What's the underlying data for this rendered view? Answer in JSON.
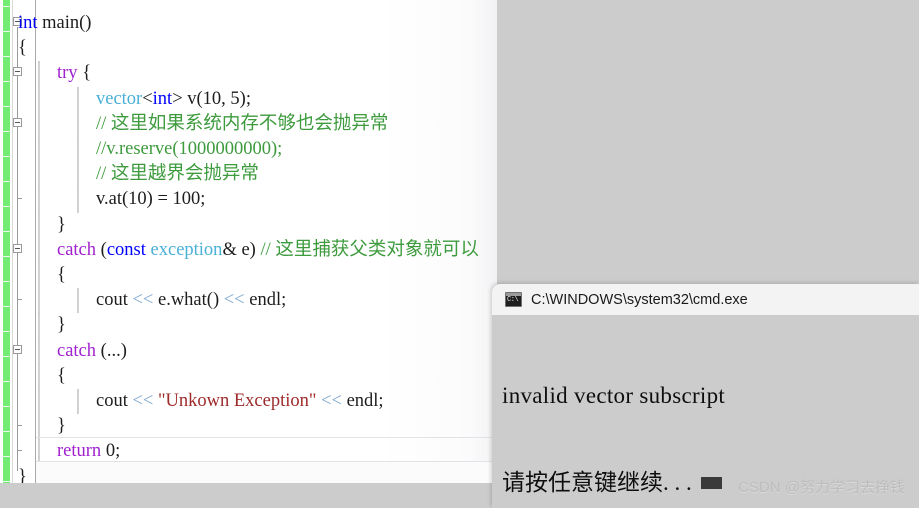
{
  "editor": {
    "name": "code-editor",
    "language": "cpp",
    "change_bar_color": "#72ec72",
    "background": "#ffffff",
    "lines": [
      {
        "indent": 0,
        "tokens": [
          {
            "t": "int",
            "c": "kw"
          },
          {
            "t": " main()",
            "c": "pl"
          }
        ]
      },
      {
        "indent": 0,
        "tokens": [
          {
            "t": "{",
            "c": "brc"
          }
        ]
      },
      {
        "indent": 1,
        "tokens": [
          {
            "t": "try",
            "c": "kw2"
          },
          {
            "t": " {",
            "c": "pl"
          }
        ]
      },
      {
        "indent": 2,
        "tokens": [
          {
            "t": "vector",
            "c": "type"
          },
          {
            "t": "<",
            "c": "pl"
          },
          {
            "t": "int",
            "c": "kw"
          },
          {
            "t": "> v(10, 5);",
            "c": "pl"
          }
        ]
      },
      {
        "indent": 2,
        "tokens": [
          {
            "t": "// 这里如果系统内存不够也会抛异常",
            "c": "cmt"
          }
        ]
      },
      {
        "indent": 2,
        "tokens": [
          {
            "t": "//v.reserve(1000000000);",
            "c": "cmt"
          }
        ]
      },
      {
        "indent": 2,
        "tokens": [
          {
            "t": "// 这里越界会抛异常",
            "c": "cmt"
          }
        ]
      },
      {
        "indent": 2,
        "tokens": [
          {
            "t": "v.at(10) = 100;",
            "c": "pl"
          }
        ]
      },
      {
        "indent": 1,
        "tokens": [
          {
            "t": "}",
            "c": "brc"
          }
        ]
      },
      {
        "indent": 1,
        "tokens": [
          {
            "t": "catch",
            "c": "kw2"
          },
          {
            "t": " (",
            "c": "pl"
          },
          {
            "t": "const",
            "c": "kw"
          },
          {
            "t": " ",
            "c": "pl"
          },
          {
            "t": "exception",
            "c": "type"
          },
          {
            "t": "& e) ",
            "c": "pl"
          },
          {
            "t": "// 这里捕获父类对象就可以",
            "c": "cmt"
          }
        ]
      },
      {
        "indent": 1,
        "tokens": [
          {
            "t": "{",
            "c": "brc"
          }
        ]
      },
      {
        "indent": 2,
        "tokens": [
          {
            "t": "cout ",
            "c": "pl"
          },
          {
            "t": "<<",
            "c": "op"
          },
          {
            "t": " e.what() ",
            "c": "pl"
          },
          {
            "t": "<<",
            "c": "op"
          },
          {
            "t": " endl;",
            "c": "pl"
          }
        ]
      },
      {
        "indent": 1,
        "tokens": [
          {
            "t": "}",
            "c": "brc"
          }
        ]
      },
      {
        "indent": 1,
        "tokens": [
          {
            "t": "catch",
            "c": "kw2"
          },
          {
            "t": " (...)",
            "c": "pl"
          }
        ]
      },
      {
        "indent": 1,
        "tokens": [
          {
            "t": "{",
            "c": "brc"
          }
        ]
      },
      {
        "indent": 2,
        "tokens": [
          {
            "t": "cout ",
            "c": "pl"
          },
          {
            "t": "<<",
            "c": "op"
          },
          {
            "t": " ",
            "c": "pl"
          },
          {
            "t": "\"Unkown Exception\"",
            "c": "str"
          },
          {
            "t": " ",
            "c": "pl"
          },
          {
            "t": "<<",
            "c": "op"
          },
          {
            "t": " endl;",
            "c": "pl"
          }
        ]
      },
      {
        "indent": 1,
        "tokens": [
          {
            "t": "}",
            "c": "brc"
          }
        ]
      },
      {
        "indent": 1,
        "tokens": [
          {
            "t": "return",
            "c": "kw2"
          },
          {
            "t": " 0;",
            "c": "pl"
          }
        ]
      },
      {
        "indent": 0,
        "tokens": [
          {
            "t": "}",
            "c": "brc"
          }
        ]
      }
    ],
    "fold_markers": [
      0,
      2,
      4,
      9,
      13
    ],
    "colors": {
      "keyword": "#0000ff",
      "keyword_control": "#a020d0",
      "type": "#49b0d8",
      "comment": "#3d9b3d",
      "string": "#9e2a2a",
      "operator": "#7fa7cf",
      "plain": "#1d1d1d"
    }
  },
  "console": {
    "title": "C:\\WINDOWS\\system32\\cmd.exe",
    "icon": "cmd-icon",
    "icon_glyph": "C:\\",
    "background": "#cccccc",
    "titlebar_background": "#f3f3f3",
    "output": [
      "invalid vector subscript",
      "请按任意键继续. . ."
    ]
  },
  "watermark": {
    "text": "CSDN @努力学习去挣钱"
  }
}
